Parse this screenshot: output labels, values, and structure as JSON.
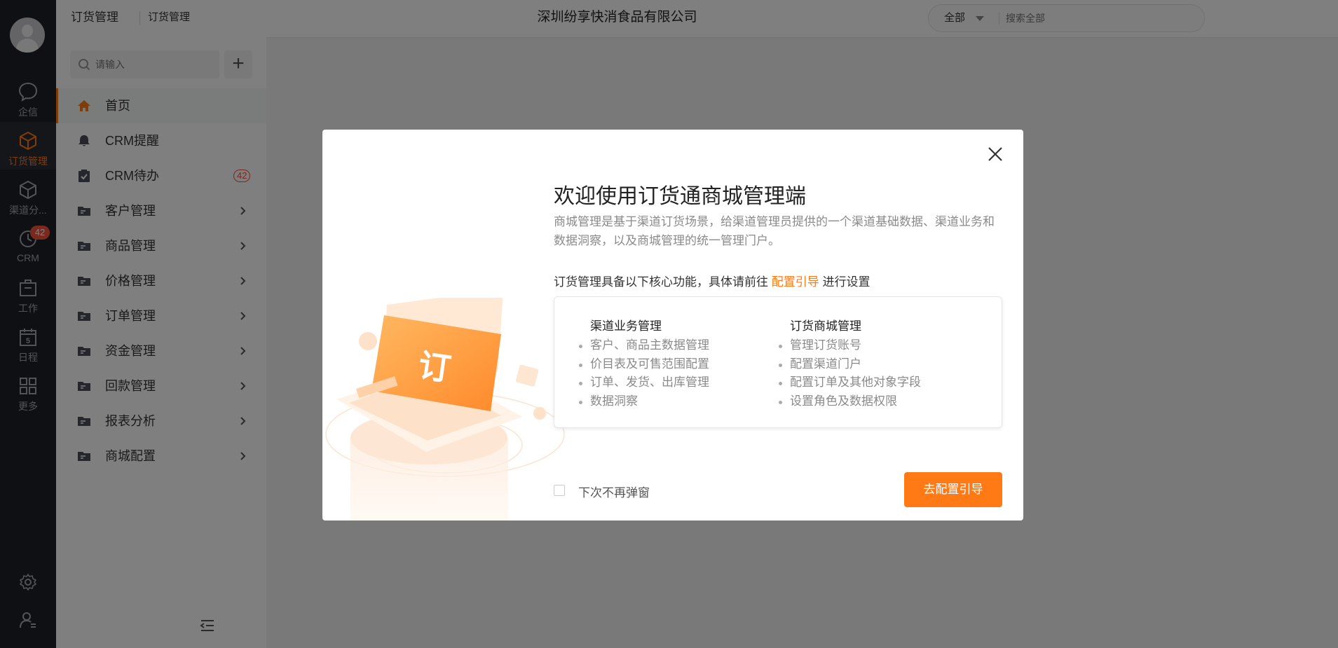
{
  "rail": {
    "items": [
      {
        "label": "企信",
        "icon": "chat-icon"
      },
      {
        "label": "订货管理",
        "icon": "box-icon"
      },
      {
        "label": "渠道分...",
        "icon": "cube-icon"
      },
      {
        "label": "CRM",
        "icon": "clock-icon",
        "badge": "42"
      },
      {
        "label": "工作",
        "icon": "briefcase-icon"
      },
      {
        "label": "日程",
        "icon": "calendar-icon",
        "day": "5"
      },
      {
        "label": "更多",
        "icon": "grid-icon"
      }
    ],
    "bottom": [
      "gear-icon",
      "user-settings-icon"
    ]
  },
  "sidebar": {
    "breadcrumb_1": "订货管理",
    "breadcrumb_2": "订货管理",
    "search_placeholder": "请输入",
    "add_label": "+",
    "items": [
      {
        "label": "首页"
      },
      {
        "label": "CRM提醒"
      },
      {
        "label": "CRM待办",
        "count": "42"
      },
      {
        "label": "客户管理"
      },
      {
        "label": "商品管理"
      },
      {
        "label": "价格管理"
      },
      {
        "label": "订单管理"
      },
      {
        "label": "资金管理"
      },
      {
        "label": "回款管理"
      },
      {
        "label": "报表分析"
      },
      {
        "label": "商城配置"
      }
    ]
  },
  "header": {
    "company": "深圳纷享快消食品有限公司",
    "search_scope": "全部",
    "search_placeholder": "搜索全部"
  },
  "modal": {
    "title": "欢迎使用订货通商城管理端",
    "description": "商城管理是基于渠道订货场景，给渠道管理员提供的一个渠道基础数据、渠道业务和数据洞察，以及商城管理的统一管理门户。",
    "core_prefix": "订货管理具备以下核心功能，具体请前往",
    "core_link": "配置引导",
    "core_suffix": "进行设置",
    "col1": {
      "title": "渠道业务管理",
      "items": [
        "客户、商品主数据管理",
        "价目表及可售范围配置",
        "订单、发货、出库管理",
        "数据洞察"
      ]
    },
    "col2": {
      "title": "订货商城管理",
      "items": [
        "管理订货账号",
        "配置渠道门户",
        "配置订单及其他对象字段",
        "设置角色及数据权限"
      ]
    },
    "illustration_text": "订",
    "checkbox_label": "下次不再弹窗",
    "primary_button": "去配置引导"
  },
  "colors": {
    "accent": "#ff7a14",
    "rail_bg": "#1f2129",
    "badge": "#f5533d"
  }
}
